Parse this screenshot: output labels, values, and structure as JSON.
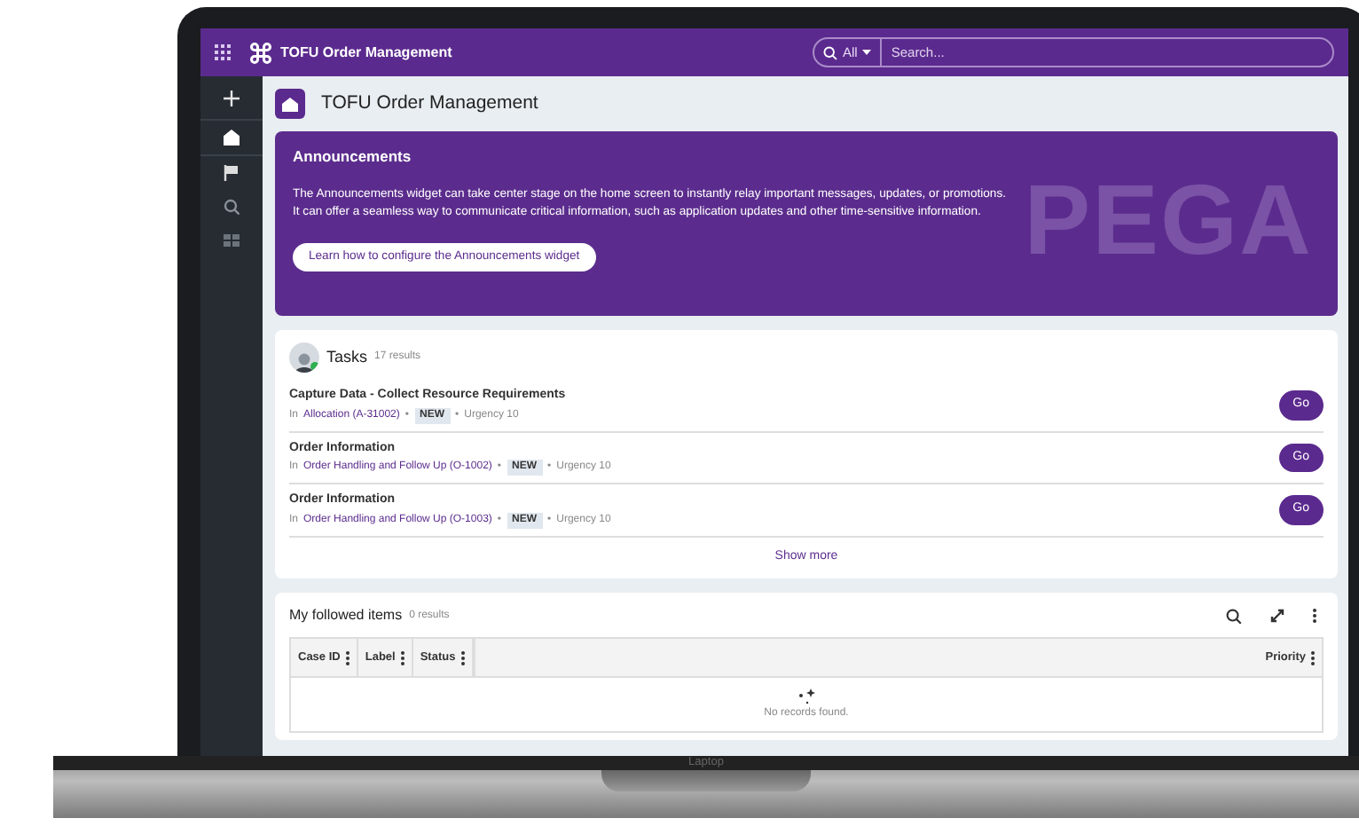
{
  "app": {
    "title": "TOFU Order Management",
    "search": {
      "scope": "All",
      "placeholder": "Search..."
    }
  },
  "sidebar": {
    "items": [
      {
        "kind": "add"
      },
      {
        "kind": "home"
      },
      {
        "kind": "flag"
      },
      {
        "kind": "search"
      },
      {
        "kind": "grid"
      }
    ]
  },
  "page_title": "TOFU Order Management",
  "announcements": {
    "title": "Announcements",
    "text": "The Announcements widget can take center stage on the home screen to instantly relay important messages, updates, or promotions. It can offer a seamless way to communicate critical information, such as application updates and other time-sensitive information.",
    "button": "Learn how to configure the Announcements widget",
    "background_logo": "PEGA"
  },
  "tasks": {
    "title": "Tasks",
    "count": "17 results",
    "separator": "•",
    "items": [
      {
        "title": "Capture Data - Collect Resource Requirements",
        "prefix": "In",
        "case": "Allocation (A-31002)",
        "status": "NEW",
        "urgency": "Urgency 10",
        "button": "Go"
      },
      {
        "title": "Order Information",
        "prefix": "In",
        "case": "Order Handling and Follow Up (O-1002)",
        "status": "NEW",
        "urgency": "Urgency 10",
        "button": "Go"
      },
      {
        "title": "Order Information",
        "prefix": "In",
        "case": "Order Handling and Follow Up (O-1003)",
        "status": "NEW",
        "urgency": "Urgency 10",
        "button": "Go"
      }
    ],
    "show_more": "Show more"
  },
  "followed": {
    "title": "My followed items",
    "count": "0 results",
    "columns": [
      {
        "label": "Case ID"
      },
      {
        "label": "Label"
      },
      {
        "label": "Status"
      },
      {
        "label": "Priority"
      }
    ],
    "empty": "No records found."
  },
  "laptop": {
    "label": "Laptop"
  }
}
